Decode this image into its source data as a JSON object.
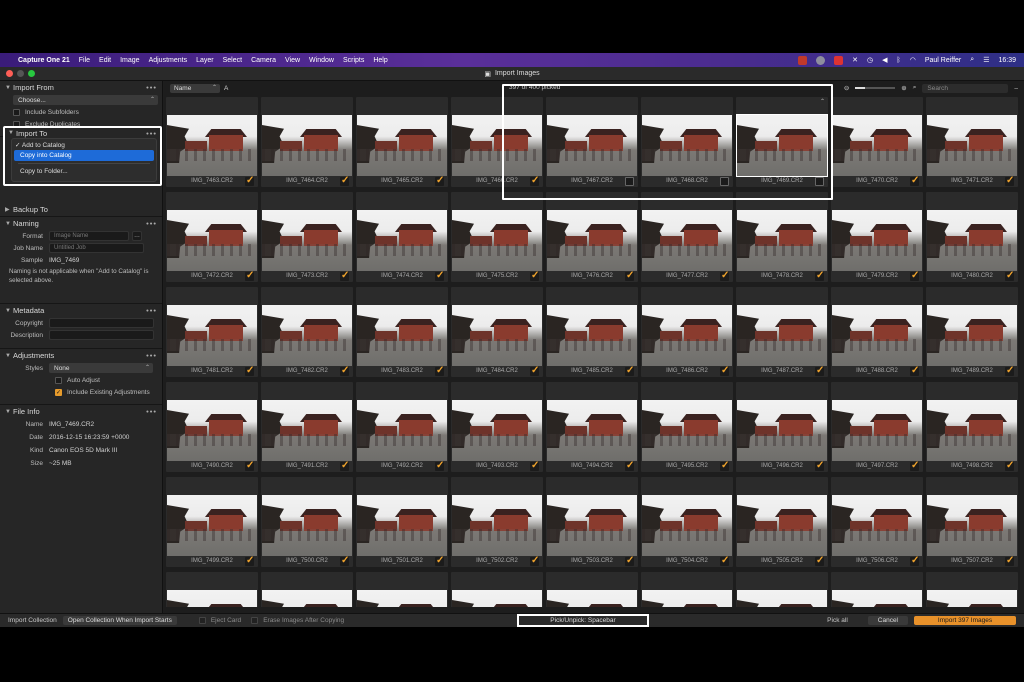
{
  "menubar": {
    "app": "Capture One 21",
    "items": [
      "File",
      "Edit",
      "Image",
      "Adjustments",
      "Layer",
      "Select",
      "Camera",
      "View",
      "Window",
      "Scripts",
      "Help"
    ],
    "user": "Paul Reiffer",
    "time": "16:39"
  },
  "window": {
    "title": "Import Images"
  },
  "panel": {
    "import_from": {
      "title": "Import From",
      "source": "Choose...",
      "include_subfolders": "Include Subfolders",
      "exclude_duplicates": "Exclude Duplicates"
    },
    "import_to": {
      "title": "Import To",
      "options": [
        "✓ Add to Catalog",
        "Copy into Catalog",
        "Copy to Folder..."
      ]
    },
    "backup_to": {
      "title": "Backup To"
    },
    "naming": {
      "title": "Naming",
      "format_label": "Format",
      "format_placeholder": "Image Name",
      "job_label": "Job Name",
      "job_placeholder": "Untitled Job",
      "sample_label": "Sample",
      "sample_value": "IMG_7469",
      "note": "Naming is not applicable when \"Add to Catalog\" is selected above."
    },
    "metadata": {
      "title": "Metadata",
      "copyright_label": "Copyright",
      "description_label": "Description"
    },
    "adjustments": {
      "title": "Adjustments",
      "styles_label": "Styles",
      "styles_value": "None",
      "auto_adjust": "Auto Adjust",
      "include_existing": "Include Existing Adjustments"
    },
    "file_info": {
      "title": "File Info",
      "rows": [
        {
          "label": "Name",
          "value": "IMG_7469.CR2"
        },
        {
          "label": "Date",
          "value": "2016-12-15 16:23:59 +0000"
        },
        {
          "label": "Kind",
          "value": "Canon EOS 5D Mark III"
        },
        {
          "label": "Size",
          "value": "~25 MB"
        }
      ]
    }
  },
  "toolbar": {
    "sort": "Name",
    "sort_dir": "A",
    "picked": "397 of 400 picked",
    "search_placeholder": "Search"
  },
  "images": [
    [
      "IMG_7463.CR2",
      true
    ],
    [
      "IMG_7464.CR2",
      true
    ],
    [
      "IMG_7465.CR2",
      true
    ],
    [
      "IMG_7466.CR2",
      true
    ],
    [
      "IMG_7467.CR2",
      false
    ],
    [
      "IMG_7468.CR2",
      false
    ],
    [
      "IMG_7469.CR2",
      false
    ],
    [
      "IMG_7470.CR2",
      true
    ],
    [
      "IMG_7471.CR2",
      true
    ],
    [
      "IMG_7472.CR2",
      true
    ],
    [
      "IMG_7473.CR2",
      true
    ],
    [
      "IMG_7474.CR2",
      true
    ],
    [
      "IMG_7475.CR2",
      true
    ],
    [
      "IMG_7476.CR2",
      true
    ],
    [
      "IMG_7477.CR2",
      true
    ],
    [
      "IMG_7478.CR2",
      true
    ],
    [
      "IMG_7479.CR2",
      true
    ],
    [
      "IMG_7480.CR2",
      true
    ],
    [
      "IMG_7481.CR2",
      true
    ],
    [
      "IMG_7482.CR2",
      true
    ],
    [
      "IMG_7483.CR2",
      true
    ],
    [
      "IMG_7484.CR2",
      true
    ],
    [
      "IMG_7485.CR2",
      true
    ],
    [
      "IMG_7486.CR2",
      true
    ],
    [
      "IMG_7487.CR2",
      true
    ],
    [
      "IMG_7488.CR2",
      true
    ],
    [
      "IMG_7489.CR2",
      true
    ],
    [
      "IMG_7490.CR2",
      true
    ],
    [
      "IMG_7491.CR2",
      true
    ],
    [
      "IMG_7492.CR2",
      true
    ],
    [
      "IMG_7493.CR2",
      true
    ],
    [
      "IMG_7494.CR2",
      true
    ],
    [
      "IMG_7495.CR2",
      true
    ],
    [
      "IMG_7496.CR2",
      true
    ],
    [
      "IMG_7497.CR2",
      true
    ],
    [
      "IMG_7498.CR2",
      true
    ],
    [
      "IMG_7499.CR2",
      true
    ],
    [
      "IMG_7500.CR2",
      true
    ],
    [
      "IMG_7501.CR2",
      true
    ],
    [
      "IMG_7502.CR2",
      true
    ],
    [
      "IMG_7503.CR2",
      true
    ],
    [
      "IMG_7504.CR2",
      true
    ],
    [
      "IMG_7505.CR2",
      true
    ],
    [
      "IMG_7506.CR2",
      true
    ],
    [
      "IMG_7507.CR2",
      true
    ]
  ],
  "selected_image": "IMG_7469.CR2",
  "bottom": {
    "collection_label": "Import Collection",
    "collection_value": "Open Collection When Import Starts",
    "eject": "Eject Card",
    "erase": "Erase Images After Copying",
    "hint": "Pick/Unpick: Spacebar",
    "pick_all": "Pick all",
    "cancel": "Cancel",
    "import": "Import 397 Images"
  },
  "colors": {
    "accent": "#e8912a",
    "highlight": "#1e6bd8"
  }
}
